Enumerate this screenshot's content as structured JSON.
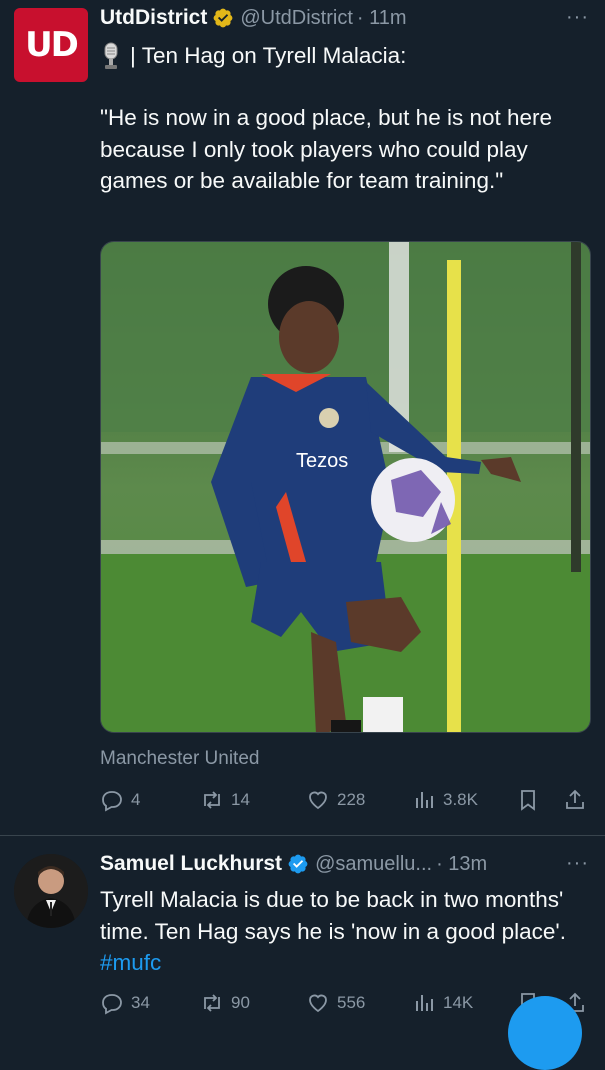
{
  "tweet1": {
    "author_name": "UtdDistrict",
    "handle": "@UtdDistrict",
    "time": "· 11m",
    "avatar_text": "UD",
    "text_line1": "| Ten Hag on Tyrell Malacia:",
    "text_quote": "\"He is now in a good place, but he is not here because I only took players who could play games or be available for team training.\"",
    "source": "Manchester United",
    "replies": "4",
    "retweets": "14",
    "likes": "228",
    "views": "3.8K",
    "media_sponsor": "Tezos"
  },
  "tweet2": {
    "author_name": "Samuel Luckhurst",
    "handle": "@samuellu...",
    "time": "· 13m",
    "text": "Tyrell Malacia is due to be back in two months' time. Ten Hag says he is 'now in a good place'.",
    "hashtag": "#mufc",
    "replies": "34",
    "retweets": "90",
    "likes": "556",
    "views": "14K"
  },
  "more_label": "···",
  "colors": {
    "background": "#15202b",
    "accent": "#1d9bf0",
    "secondary_text": "#8b98a5",
    "verified": "#e2b719"
  },
  "icons": [
    "microphone-icon",
    "verified-badge-icon",
    "reply-icon",
    "retweet-icon",
    "like-icon",
    "views-icon",
    "bookmark-icon",
    "share-icon",
    "more-icon"
  ]
}
